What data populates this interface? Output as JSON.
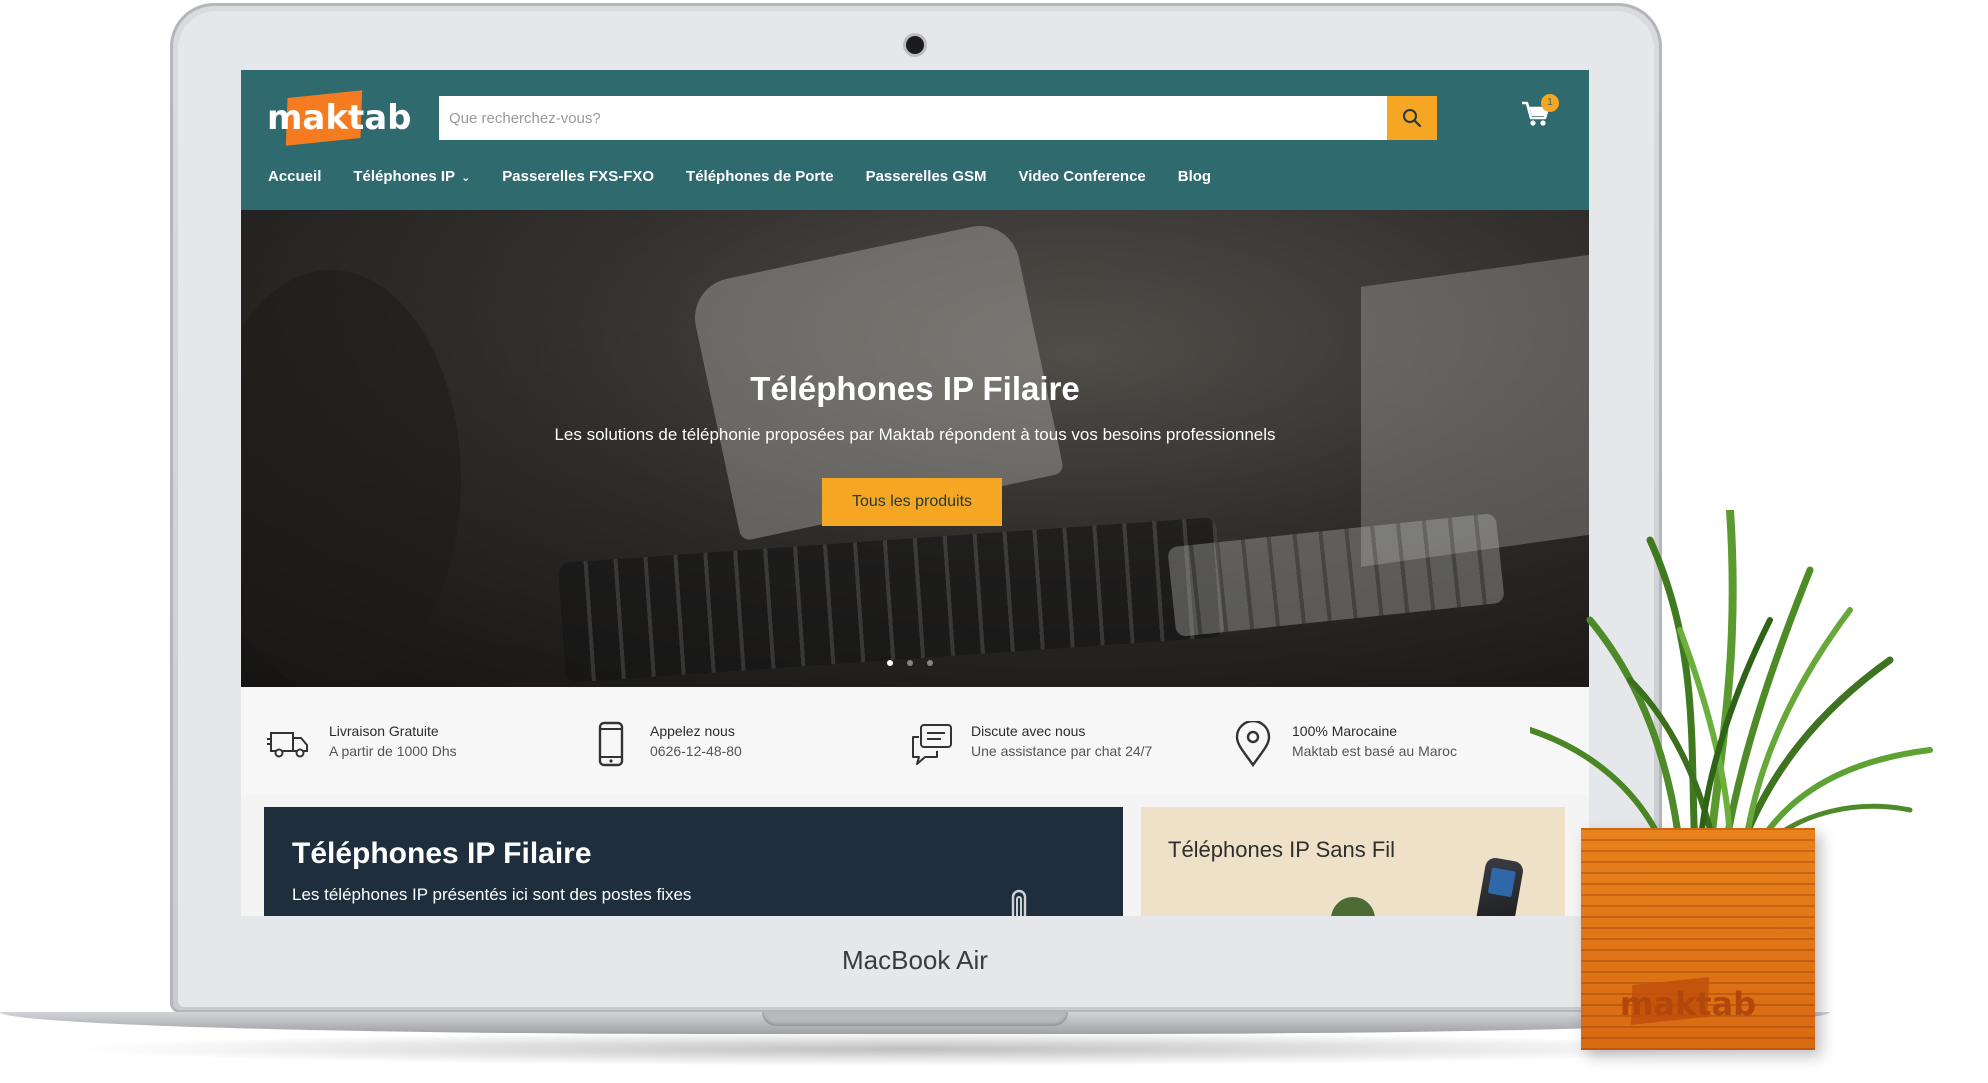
{
  "device": {
    "bezel_label": "MacBook Air"
  },
  "header": {
    "logo_text": "maktab",
    "search_placeholder": "Que recherchez-vous?",
    "cart_count": "1",
    "nav": [
      {
        "label": "Accueil"
      },
      {
        "label": "Téléphones IP",
        "has_dropdown": true
      },
      {
        "label": "Passerelles FXS-FXO"
      },
      {
        "label": "Téléphones de Porte"
      },
      {
        "label": "Passerelles GSM"
      },
      {
        "label": "Video Conference"
      },
      {
        "label": "Blog"
      }
    ]
  },
  "hero": {
    "title": "Téléphones IP Filaire",
    "subtitle": "Les solutions de téléphonie proposées par Maktab répondent à tous vos besoins professionnels",
    "button_label": "Tous les produits",
    "slides_total": 3,
    "active_slide": 1
  },
  "features": [
    {
      "icon": "delivery-truck-icon",
      "title": "Livraison Gratuite",
      "subtitle": "A partir de 1000 Dhs"
    },
    {
      "icon": "mobile-phone-icon",
      "title": "Appelez nous",
      "subtitle": "0626-12-48-80"
    },
    {
      "icon": "chat-bubbles-icon",
      "title": "Discute avec nous",
      "subtitle": "Une assistance par chat 24/7"
    },
    {
      "icon": "map-pin-icon",
      "title": "100% Marocaine",
      "subtitle": "Maktab est basé au Maroc"
    }
  ],
  "categories": [
    {
      "title": "Téléphones IP Filaire",
      "description": "Les téléphones IP présentés ici sont des postes fixes"
    },
    {
      "title": "Téléphones IP Sans Fil"
    }
  ],
  "plant_pot": {
    "brand_text": "maktab"
  },
  "colors": {
    "header_bg": "#2f6a6e",
    "accent": "#f5a623",
    "logo_orange": "#f47b20",
    "dark_card": "#1e2e3c",
    "light_card": "#efe1c8"
  }
}
